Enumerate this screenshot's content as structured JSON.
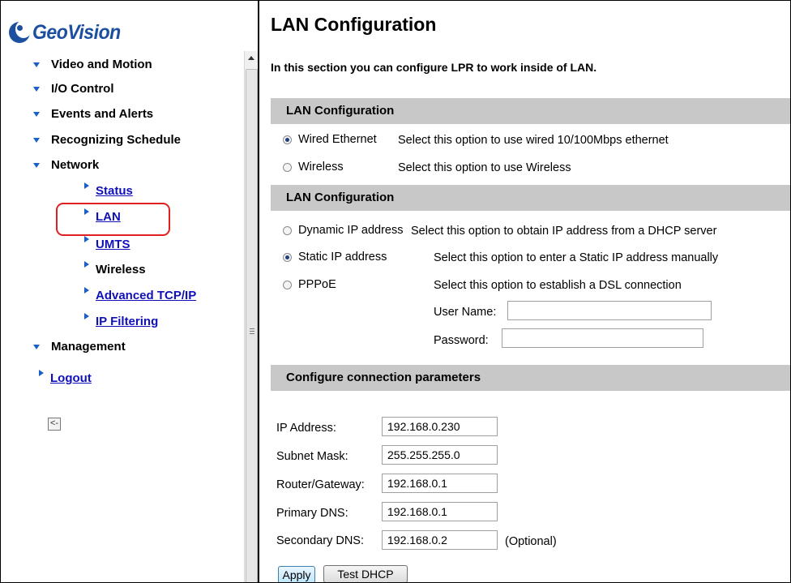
{
  "logo": {
    "text": "GeoVision"
  },
  "nav": {
    "video_motion": "Video and Motion",
    "io_control": "I/O Control",
    "events_alerts": "Events and Alerts",
    "recognizing_schedule": "Recognizing Schedule",
    "network": "Network",
    "network_items": {
      "status": "Status",
      "lan": "LAN",
      "umts": "UMTS",
      "wireless": "Wireless",
      "advanced_tcpip": "Advanced TCP/IP",
      "ip_filtering": "IP Filtering"
    },
    "management": "Management",
    "logout": "Logout",
    "collapse_label": "<-"
  },
  "page": {
    "title": "LAN Configuration",
    "intro": "In this section you can configure LPR to work inside of LAN."
  },
  "section1": {
    "header": "LAN Configuration",
    "wired_label": "Wired Ethernet",
    "wired_desc": "Select this option to use wired 10/100Mbps ethernet",
    "wireless_label": "Wireless",
    "wireless_desc": "Select this option to use Wireless",
    "selected": "wired"
  },
  "section2": {
    "header": "LAN Configuration",
    "dynamic_label": "Dynamic IP address",
    "dynamic_desc": "Select this option to obtain IP address from a DHCP server",
    "static_label": "Static IP address",
    "static_desc": "Select this option to enter a Static IP address manually",
    "pppoe_label": "PPPoE",
    "pppoe_desc": "Select this option to establish a DSL connection",
    "username_label": "User Name:",
    "username_value": "",
    "password_label": "Password:",
    "password_value": "",
    "selected": "static"
  },
  "section3": {
    "header": "Configure connection parameters",
    "ip_label": "IP Address:",
    "ip_value": "192.168.0.230",
    "subnet_label": "Subnet Mask:",
    "subnet_value": "255.255.255.0",
    "gateway_label": "Router/Gateway:",
    "gateway_value": "192.168.0.1",
    "dns1_label": "Primary DNS:",
    "dns1_value": "192.168.0.1",
    "dns2_label": "Secondary DNS:",
    "dns2_value": "192.168.0.2",
    "optional_note": "(Optional)"
  },
  "buttons": {
    "apply": "Apply",
    "test_dhcp": "Test DHCP"
  },
  "colors": {
    "logo": "#1d4fa0",
    "link": "#1010b8",
    "section_bg": "#c8c8c8",
    "highlight": "#e02020"
  }
}
